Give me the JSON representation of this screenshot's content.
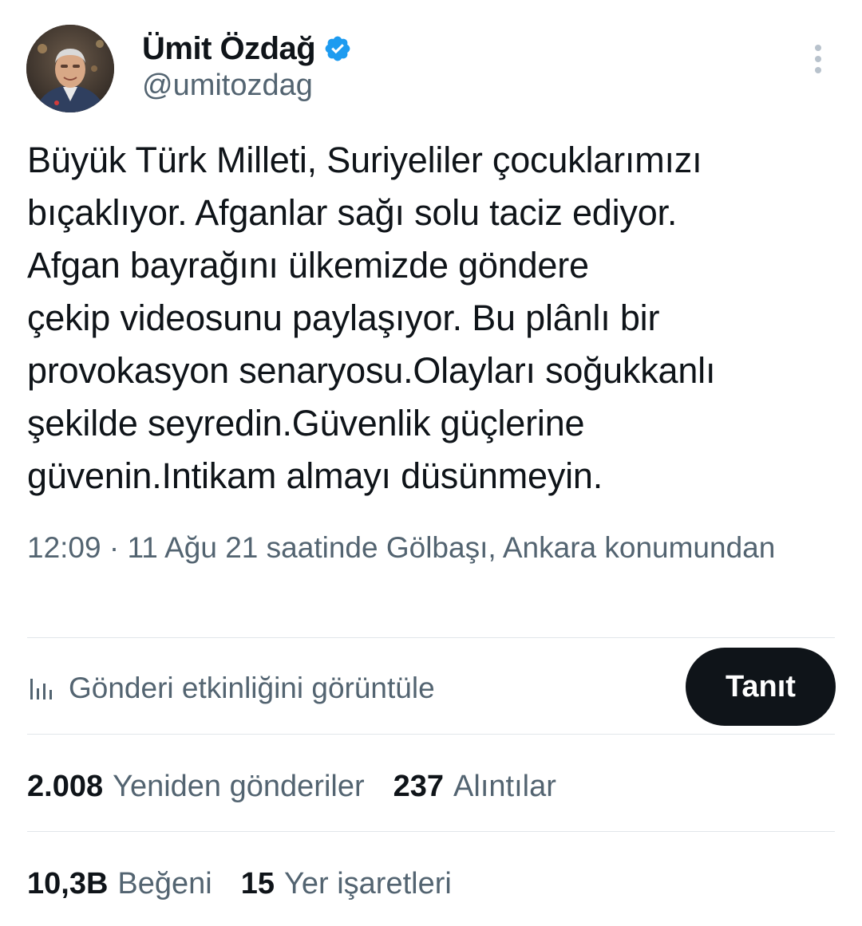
{
  "author": {
    "display_name": "Ümit Özdağ",
    "handle": "@umitozdag",
    "verified_color": "#1d9bf0"
  },
  "tweet": {
    "text": "Büyük Türk Milleti, Suriyeliler çocuklarımızı\nbıçaklıyor. Afganlar sağı solu taciz ediyor.\nAfgan bayrağını ülkemizde göndere\nçekip videosunu paylaşıyor. Bu plânlı bir\nprovokasyon senaryosu.Olayları soğukkanlı\nşekilde seyredin.Güvenlik güçlerine\ngüvenin.Intikam almayı düsünmeyin.",
    "meta": "12:09 · 11 Ağu 21 saatinde Gölbaşı, Ankara konumundan"
  },
  "activity": {
    "label": "Gönderi etkinliğini görüntüle",
    "promote_button": "Tanıt"
  },
  "stats": {
    "retweets": {
      "count": "2.008",
      "label": "Yeniden gönderiler"
    },
    "quotes": {
      "count": "237",
      "label": "Alıntılar"
    },
    "likes": {
      "count": "10,3B",
      "label": "Beğeni"
    },
    "bookmarks": {
      "count": "15",
      "label": "Yer işaretleri"
    }
  },
  "icons": {
    "verified": "verified-badge-icon",
    "more": "more-vertical-icon",
    "activity": "bar-chart-icon"
  },
  "colors": {
    "text_primary": "#0f1419",
    "text_secondary": "#536471",
    "accent": "#1d9bf0",
    "button_bg": "#0f1419"
  }
}
